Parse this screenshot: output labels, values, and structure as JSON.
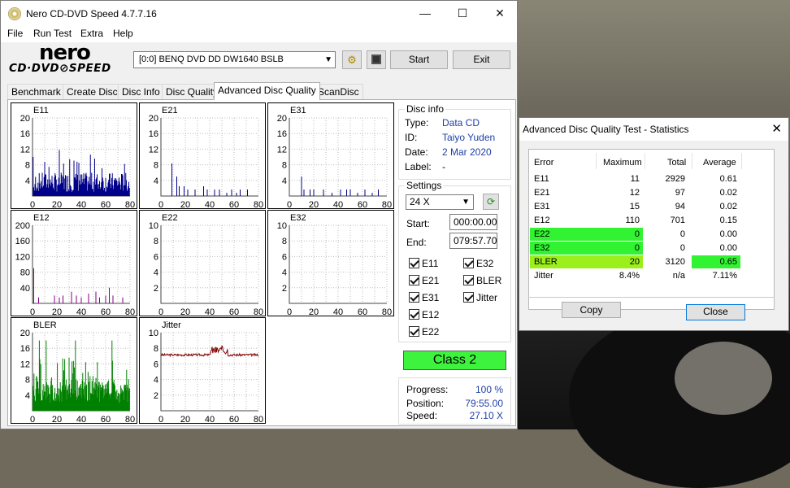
{
  "main_window": {
    "title": "Nero CD-DVD Speed 4.7.7.16",
    "controls": {
      "minimize": "—",
      "maximize": "☐",
      "close": "✕"
    },
    "menu": [
      "File",
      "Run Test",
      "Extra",
      "Help"
    ],
    "logo": {
      "line1": "nero",
      "line2": "CD·DVD⊘SPEED"
    },
    "drive": "[0:0]   BENQ DVD DD DW1640 BSLB",
    "start_label": "Start",
    "exit_label": "Exit",
    "tabs": [
      "Benchmark",
      "Create Disc",
      "Disc Info",
      "Disc Quality",
      "Advanced Disc Quality",
      "ScanDisc"
    ],
    "active_tab": "Advanced Disc Quality"
  },
  "charts": [
    {
      "name": "E11",
      "yticks": [
        "20",
        "16",
        "12",
        "8",
        "4"
      ],
      "xticks": [
        "0",
        "20",
        "40",
        "60",
        "80"
      ],
      "color": "#00008b"
    },
    {
      "name": "E21",
      "yticks": [
        "20",
        "16",
        "12",
        "8",
        "4"
      ],
      "xticks": [
        "0",
        "20",
        "40",
        "60",
        "80"
      ],
      "color": "#00008b"
    },
    {
      "name": "E31",
      "yticks": [
        "20",
        "16",
        "12",
        "8",
        "4"
      ],
      "xticks": [
        "0",
        "20",
        "40",
        "60",
        "80"
      ],
      "color": "#00008b"
    },
    {
      "name": "E12",
      "yticks": [
        "200",
        "160",
        "120",
        "80",
        "40"
      ],
      "xticks": [
        "0",
        "20",
        "40",
        "60",
        "80"
      ],
      "color": "#800080"
    },
    {
      "name": "E22",
      "yticks": [
        "10",
        "8",
        "6",
        "4",
        "2"
      ],
      "xticks": [
        "0",
        "20",
        "40",
        "60",
        "80"
      ],
      "color": "#800080"
    },
    {
      "name": "E32",
      "yticks": [
        "10",
        "8",
        "6",
        "4",
        "2"
      ],
      "xticks": [
        "0",
        "20",
        "40",
        "60",
        "80"
      ],
      "color": "#800080"
    },
    {
      "name": "BLER",
      "yticks": [
        "20",
        "16",
        "12",
        "8",
        "4"
      ],
      "xticks": [
        "0",
        "20",
        "40",
        "60",
        "80"
      ],
      "color": "#008000"
    },
    {
      "name": "Jitter",
      "yticks": [
        "10",
        "8",
        "6",
        "4",
        "2"
      ],
      "xticks": [
        "0",
        "20",
        "40",
        "60",
        "80"
      ],
      "color": "#800000"
    }
  ],
  "chart_data": [
    {
      "type": "bar",
      "title": "E11",
      "ylim": [
        0,
        20
      ],
      "xlim": [
        0,
        80
      ],
      "values": [
        3,
        8,
        4,
        2,
        6,
        5,
        9,
        3,
        4,
        2,
        5,
        3,
        7,
        2,
        3,
        2,
        4,
        3,
        2,
        3,
        4,
        2,
        3,
        2,
        5,
        3,
        2,
        4,
        3,
        2,
        3,
        2,
        4,
        2,
        3,
        5,
        2,
        3,
        2,
        3,
        4,
        2,
        3,
        2,
        3,
        2,
        4,
        3,
        2,
        3,
        2,
        3,
        2,
        3,
        4,
        2,
        3,
        2,
        3,
        5,
        2,
        3,
        2,
        3,
        2,
        4,
        3,
        2,
        3,
        2,
        3,
        2,
        4,
        3,
        2,
        3,
        2,
        3,
        2,
        3
      ]
    },
    {
      "type": "bar",
      "title": "E21",
      "spikes": [
        [
          9,
          10
        ],
        [
          13,
          6
        ],
        [
          15,
          3
        ],
        [
          19,
          3
        ],
        [
          22,
          2
        ],
        [
          28,
          2
        ],
        [
          35,
          3
        ],
        [
          38,
          2
        ],
        [
          44,
          2
        ],
        [
          48,
          2
        ],
        [
          54,
          1
        ],
        [
          58,
          2
        ],
        [
          62,
          1
        ],
        [
          65,
          2
        ],
        [
          71,
          2
        ]
      ]
    },
    {
      "type": "bar",
      "title": "E31",
      "spikes": [
        [
          10,
          6
        ],
        [
          12,
          2
        ],
        [
          17,
          2
        ],
        [
          20,
          2
        ],
        [
          28,
          2
        ],
        [
          35,
          1
        ],
        [
          42,
          2
        ],
        [
          47,
          2
        ],
        [
          50,
          2
        ],
        [
          56,
          1
        ],
        [
          62,
          2
        ],
        [
          68,
          1
        ],
        [
          73,
          2
        ]
      ]
    },
    {
      "type": "bar",
      "title": "E12",
      "ylim": [
        0,
        200
      ],
      "spikes": [
        [
          1,
          90
        ],
        [
          5,
          15
        ],
        [
          18,
          20
        ],
        [
          22,
          15
        ],
        [
          25,
          20
        ],
        [
          32,
          30
        ],
        [
          36,
          20
        ],
        [
          40,
          15
        ],
        [
          46,
          25
        ],
        [
          52,
          30
        ],
        [
          55,
          15
        ],
        [
          60,
          20
        ],
        [
          63,
          40
        ],
        [
          66,
          20
        ],
        [
          74,
          15
        ]
      ]
    },
    {
      "type": "bar",
      "title": "E22",
      "ylim": [
        0,
        10
      ],
      "values": []
    },
    {
      "type": "bar",
      "title": "E32",
      "ylim": [
        0,
        10
      ],
      "values": []
    },
    {
      "type": "bar",
      "title": "BLER",
      "ylim": [
        0,
        20
      ],
      "xlim": [
        0,
        80
      ]
    },
    {
      "type": "line",
      "title": "Jitter",
      "ylim": [
        0,
        10
      ],
      "xlim": [
        0,
        80
      ]
    }
  ],
  "disc_info": {
    "heading": "Disc info",
    "rows": [
      {
        "label": "Type:",
        "value": "Data CD"
      },
      {
        "label": "ID:",
        "value": "Taiyo Yuden"
      },
      {
        "label": "Date:",
        "value": "2 Mar 2020"
      },
      {
        "label": "Label:",
        "value": "-"
      }
    ]
  },
  "settings": {
    "heading": "Settings",
    "speed": "24 X",
    "start_label": "Start:",
    "start_value": "000:00.00",
    "end_label": "End:",
    "end_value": "079:57.70",
    "checks_left": [
      "E11",
      "E21",
      "E31",
      "E12",
      "E22"
    ],
    "checks_right": [
      "E32",
      "BLER",
      "Jitter"
    ]
  },
  "class_label": "Class 2",
  "progress": {
    "rows": [
      {
        "label": "Progress:",
        "value": "100 %"
      },
      {
        "label": "Position:",
        "value": "79:55.00"
      },
      {
        "label": "Speed:",
        "value": "27.10 X"
      }
    ]
  },
  "stats_window": {
    "title": "Advanced Disc Quality Test - Statistics",
    "headers": [
      "Error",
      "Maximum",
      "Total",
      "Average"
    ],
    "rows": [
      {
        "error": "E11",
        "max": "11",
        "total": "2929",
        "avg": "0.61"
      },
      {
        "error": "E21",
        "max": "12",
        "total": "97",
        "avg": "0.02"
      },
      {
        "error": "E31",
        "max": "15",
        "total": "94",
        "avg": "0.02"
      },
      {
        "error": "E12",
        "max": "110",
        "total": "701",
        "avg": "0.15"
      },
      {
        "error": "E22",
        "max": "0",
        "total": "0",
        "avg": "0.00"
      },
      {
        "error": "E32",
        "max": "0",
        "total": "0",
        "avg": "0.00"
      },
      {
        "error": "BLER",
        "max": "20",
        "total": "3120",
        "avg": "0.65"
      },
      {
        "error": "Jitter",
        "max": "8.4%",
        "total": "n/a",
        "avg": "7.11%"
      }
    ],
    "copy_label": "Copy",
    "close_label": "Close"
  }
}
